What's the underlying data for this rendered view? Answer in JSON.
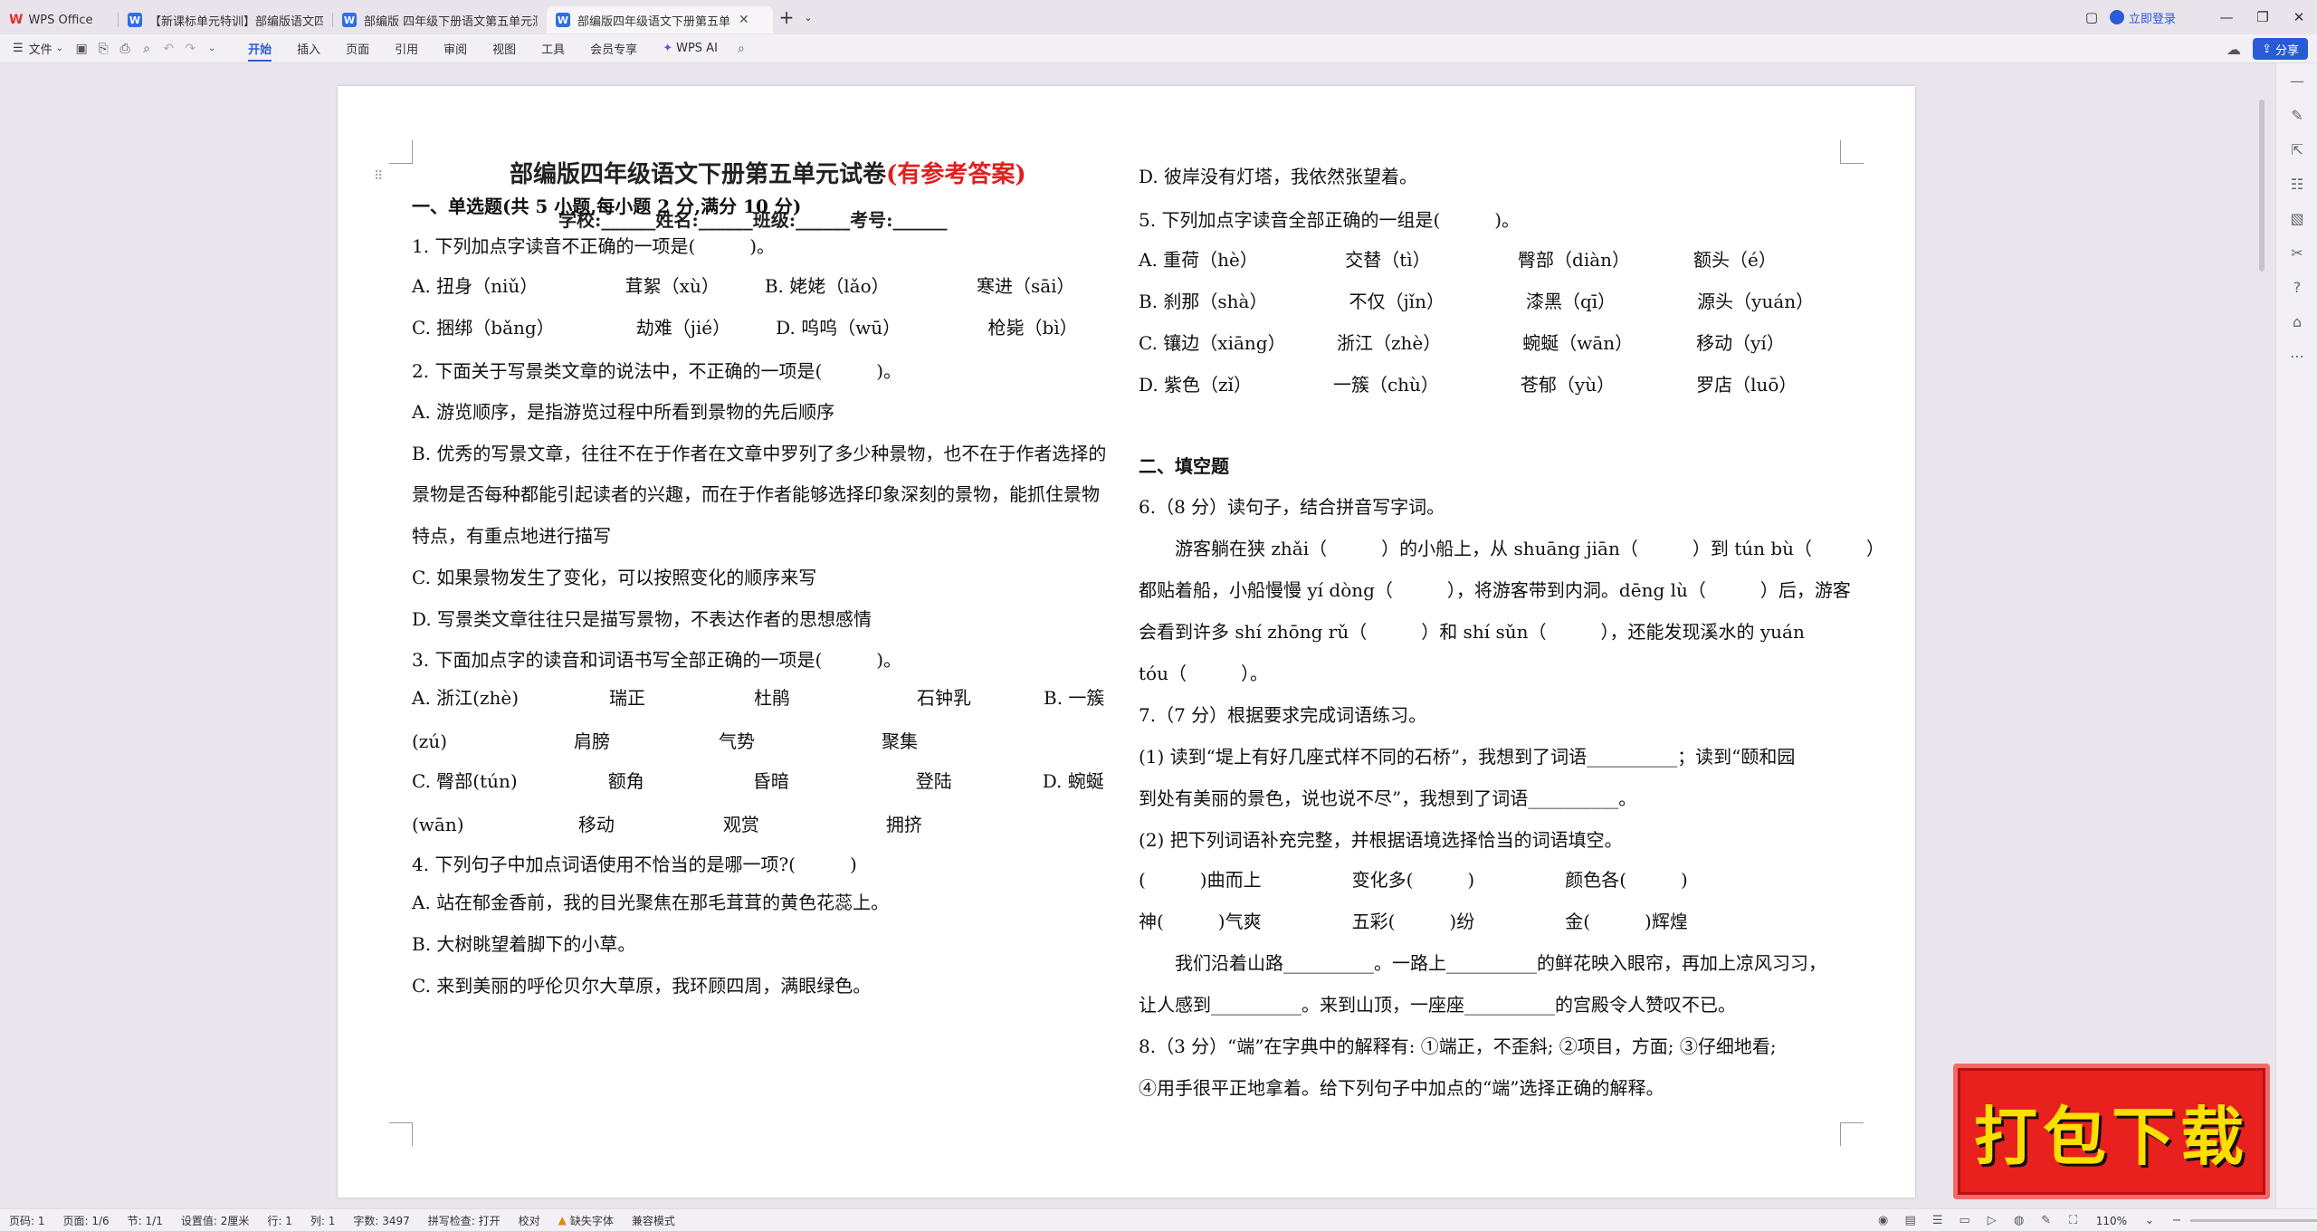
{
  "titlebar": {
    "tabs": [
      {
        "icon": "wps-logo",
        "label": "WPS Office",
        "active": false
      },
      {
        "icon": "W",
        "label": "【新课标单元特训】部编版语文四年",
        "active": false
      },
      {
        "icon": "W",
        "label": "部编版 四年级下册语文第五单元测试",
        "active": false
      },
      {
        "icon": "W",
        "label": "部编版四年级语文下册第五单",
        "active": true
      }
    ],
    "new_tab": "+",
    "login": "立即登录"
  },
  "toolbar": {
    "file": "文件",
    "menus": [
      "开始",
      "插入",
      "页面",
      "引用",
      "审阅",
      "视图",
      "工具",
      "会员专享"
    ],
    "ai": "WPS AI",
    "share": "分享"
  },
  "doc": {
    "title": "部编版四年级语文下册第五单元试卷",
    "title_red": "(有参考答案)",
    "info": "学校:______姓名:______班级:______考号:______",
    "left_lines": [
      {
        "t": "一、单选题(共 5 小题,每小题 2 分,满分 10 分)",
        "b": true
      },
      {
        "t": "1. 下列加点字读音不正确的一项是(　　　)。"
      },
      {
        "t": "A. 扭身（niǔ）　　　　　 茸絮（xù）　　　B. 姥姥（lǎo）　　　　　 寒进（sāi）"
      },
      {
        "t": "C. 捆绑（bǎng）　　　　　劫难（jié）　　　D. 呜呜（wū）　　　　　 枪毙（bì）"
      },
      {
        "t": "2. 下面关于写景类文章的说法中，不正确的一项是(　　　)。"
      },
      {
        "t": "A. 游览顺序，是指游览过程中所看到景物的先后顺序"
      },
      {
        "t": "B. 优秀的写景文章，往往不在于作者在文章中罗列了多少种景物，也不在于作者选择的"
      },
      {
        "t": "景物是否每种都能引起读者的兴趣，而在于作者能够选择印象深刻的景物，能抓住景物"
      },
      {
        "t": "特点，有重点地进行描写"
      },
      {
        "t": "C. 如果景物发生了变化，可以按照变化的顺序来写"
      },
      {
        "t": "D. 写景类文章往往只是描写景物，不表达作者的思想感情"
      },
      {
        "t": "3. 下面加点字的读音和词语书写全部正确的一项是(　　　)。"
      },
      {
        "t": "A. 浙江(zhè)　　　　　瑞正　　　　　　杜鹃　　　　　　　石钟乳　　　　B. 一簇"
      },
      {
        "t": "(zú)　　　　　　　肩膀　　　　　　气势　　　　　　　聚集"
      },
      {
        "t": "C. 臀部(tún)　　　　　额角　　　　　　昏暗　　　　　　　登陆　　　　　D. 蜿蜒"
      },
      {
        "t": "(wān)　　　　　　 移动　　　　　　观赏　　　　　　　拥挤"
      },
      {
        "t": "4. 下列句子中加点词语使用不恰当的是哪一项?(　　　)"
      },
      {
        "t": "A. 站在郁金香前，我的目光聚焦在那毛茸茸的黄色花蕊上。"
      },
      {
        "t": "B. 大树眺望着脚下的小草。"
      },
      {
        "t": "C. 来到美丽的呼伦贝尔大草原，我环顾四周，满眼绿色。"
      }
    ],
    "right_lines": [
      {
        "t": "D. 彼岸没有灯塔，我依然张望着。"
      },
      {
        "t": "5. 下列加点字读音全部正确的一组是(　　　)。"
      },
      {
        "t": "A. 重荷（hè）　　　　　 交替（tì）　　　　　 臀部（diàn）　　　　额头（é）"
      },
      {
        "t": "B. 刹那（shà）　　　　　不仅（jǐn）　　　　　漆黑（qī）　　　　　源头（yuán）"
      },
      {
        "t": "C. 镶边（xiāng）　　　 浙江（zhè）　　　　　蜿蜒（wān）　　　　移动（yí）"
      },
      {
        "t": "D. 紫色（zǐ）　　　　　一簇（chù）　　　　　苍郁（yù）　　　　　罗店（luō）"
      },
      {
        "t": "二、填空题",
        "b": true
      },
      {
        "t": "6.（8 分）读句子，结合拼音写字词。"
      },
      {
        "t": "　　游客躺在狭 zhǎi（　　　）的小船上，从 shuāng jiān（　　　）到 tún bù（　　　）"
      },
      {
        "t": "都贴着船，小船慢慢 yí dòng（　　　），将游客带到内洞。dēng lù（　　　）后，游客"
      },
      {
        "t": "会看到许多 shí zhōng rǔ（　　　）和 shí sǔn（　　　），还能发现溪水的 yuán"
      },
      {
        "t": "tóu（　　　）。"
      },
      {
        "t": "7.（7 分）根据要求完成词语练习。"
      },
      {
        "t": "(1) 读到“堤上有好几座式样不同的石桥”，我想到了词语__________；读到“颐和园"
      },
      {
        "t": "到处有美丽的景色，说也说不尽”，我想到了词语__________。"
      },
      {
        "t": "(2) 把下列词语补充完整，并根据语境选择恰当的词语填空。"
      },
      {
        "t": "(　　　)曲而上　　　　　变化多(　　　)　　　　　颜色各(　　　)"
      },
      {
        "t": "神(　　　)气爽　　　　　五彩(　　　)纷　　　　　金(　　　)辉煌"
      },
      {
        "t": "　　我们沿着山路__________。一路上__________的鲜花映入眼帘，再加上凉风习习，"
      },
      {
        "t": "让人感到__________。来到山顶，一座座__________的宫殿令人赞叹不已。"
      },
      {
        "t": "8.（3 分）“端”在字典中的解释有: ①端正，不歪斜; ②项目，方面; ③仔细地看;"
      },
      {
        "t": "④用手很平正地拿着。给下列句子中加点的“端”选择正确的解释。"
      }
    ]
  },
  "statusbar": {
    "items": [
      "页码: 1",
      "页面: 1/6",
      "节: 1/1",
      "设置值: 2厘米",
      "行: 1",
      "列: 1",
      "字数: 3497",
      "拼写检查: 打开",
      "校对",
      "缺失字体",
      "兼容模式"
    ],
    "zoom": "110%"
  },
  "promo": {
    "text": "打包下载"
  }
}
